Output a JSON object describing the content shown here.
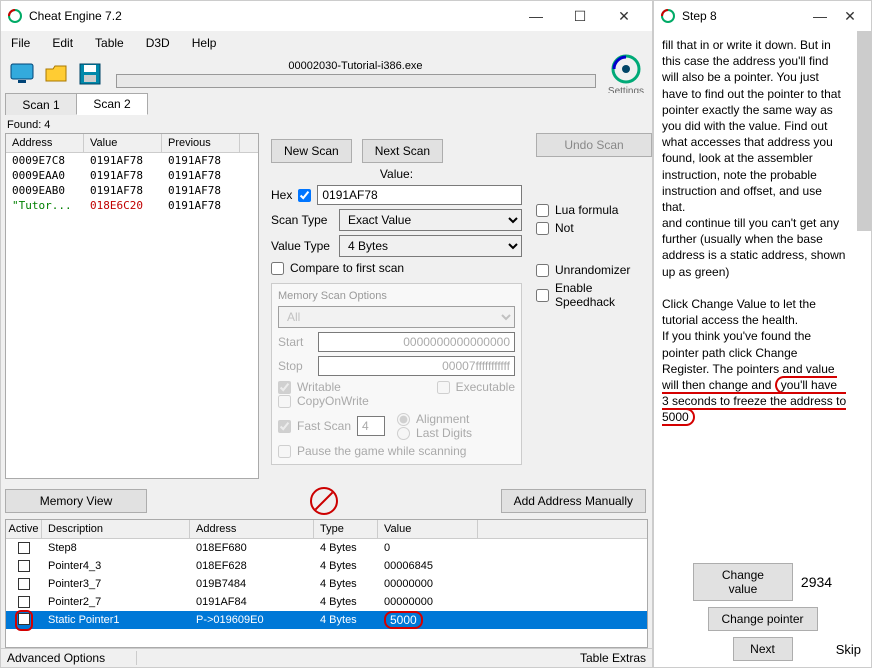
{
  "main": {
    "title": "Cheat Engine 7.2",
    "menu": [
      "File",
      "Edit",
      "Table",
      "D3D",
      "Help"
    ],
    "process": "00002030-Tutorial-i386.exe",
    "settings_label": "Settings",
    "tabs": [
      "Scan 1",
      "Scan 2"
    ],
    "active_tab": 1,
    "found_label": "Found: 4",
    "results": {
      "headers": [
        "Address",
        "Value",
        "Previous"
      ],
      "rows": [
        {
          "addr": "0009E7C8",
          "val": "0191AF78",
          "prev": "0191AF78",
          "addr_color": "#000",
          "val_color": "#000"
        },
        {
          "addr": "0009EAA0",
          "val": "0191AF78",
          "prev": "0191AF78",
          "addr_color": "#000",
          "val_color": "#000"
        },
        {
          "addr": "0009EAB0",
          "val": "0191AF78",
          "prev": "0191AF78",
          "addr_color": "#000",
          "val_color": "#000"
        },
        {
          "addr": "\"Tutor...",
          "val": "018E6C20",
          "prev": "0191AF78",
          "addr_color": "#008000",
          "val_color": "#c00000"
        }
      ]
    },
    "scan": {
      "new_scan": "New Scan",
      "next_scan": "Next Scan",
      "undo_scan": "Undo Scan",
      "value_label": "Value:",
      "hex_label": "Hex",
      "value": "0191AF78",
      "scan_type_label": "Scan Type",
      "scan_type": "Exact Value",
      "value_type_label": "Value Type",
      "value_type": "4 Bytes",
      "compare_first": "Compare to first scan",
      "lua_formula": "Lua formula",
      "not": "Not",
      "unrandomizer": "Unrandomizer",
      "speedhack": "Enable Speedhack",
      "mem_opts_title": "Memory Scan Options",
      "region": "All",
      "start_label": "Start",
      "start": "0000000000000000",
      "stop_label": "Stop",
      "stop": "00007fffffffffff",
      "writable": "Writable",
      "executable": "Executable",
      "cow": "CopyOnWrite",
      "fast_scan": "Fast Scan",
      "fast_val": "4",
      "alignment": "Alignment",
      "last_digits": "Last Digits",
      "pause": "Pause the game while scanning"
    },
    "memory_view": "Memory View",
    "add_manual": "Add Address Manually",
    "addrlist": {
      "headers": [
        "Active",
        "Description",
        "Address",
        "Type",
        "Value"
      ],
      "rows": [
        {
          "desc": "Step8",
          "addr": "018EF680",
          "type": "4 Bytes",
          "val": "0",
          "sel": false
        },
        {
          "desc": "Pointer4_3",
          "addr": "018EF628",
          "type": "4 Bytes",
          "val": "00006845",
          "sel": false
        },
        {
          "desc": "Pointer3_7",
          "addr": "019B7484",
          "type": "4 Bytes",
          "val": "00000000",
          "sel": false
        },
        {
          "desc": "Pointer2_7",
          "addr": "0191AF84",
          "type": "4 Bytes",
          "val": "00000000",
          "sel": false
        },
        {
          "desc": "Static Pointer1",
          "addr": "P->019609E0",
          "type": "4 Bytes",
          "val": "5000",
          "sel": true
        }
      ]
    },
    "adv_opts": "Advanced Options",
    "table_extras": "Table Extras"
  },
  "side": {
    "title": "Step 8",
    "text1": "fill that in or write it down. But in this case the address you'll find will also be a pointer. You just have to find out the pointer to that pointer exactly the same way as you did with the value. Find out what accesses that address you found, look at the assembler instruction, note the probable instruction and offset, and use that.",
    "text2": "and continue till you can't get any further (usually when the base address is a static address, shown up as green)",
    "text3": "Click Change Value to let the tutorial access the health.",
    "text4": "If you think you've found the pointer path click Change Register. The pointers and value will then change and ",
    "text5": "you'll have 3 seconds to freeze the address to 5000",
    "change_value": "Change value",
    "current_value": "2934",
    "change_pointer": "Change pointer",
    "next": "Next",
    "skip": "Skip"
  }
}
